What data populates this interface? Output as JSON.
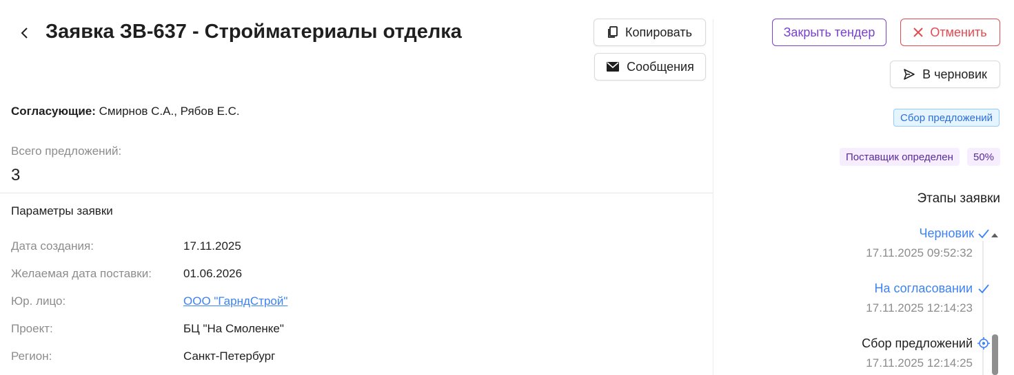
{
  "header": {
    "title": "Заявка ЗВ-637 - Стройматериалы отделка",
    "copy_label": "Копировать",
    "messages_label": "Сообщения"
  },
  "actions": {
    "close_tender_label": "Закрыть тендер",
    "cancel_label": "Отменить",
    "draft_label": "В черновик"
  },
  "approvers": {
    "label": "Согласующие:",
    "value": " Смирнов С.А., Рябов Е.С."
  },
  "offers": {
    "label": "Всего предложений:",
    "count": "3"
  },
  "params": {
    "section_title": "Параметры заявки",
    "rows": [
      {
        "label": "Дата создания:",
        "value": "17.11.2025"
      },
      {
        "label": "Желаемая дата поставки:",
        "value": "01.06.2026"
      },
      {
        "label": "Юр. лицо:",
        "value": "ООО \"ГарндСтрой\""
      },
      {
        "label": "Проект:",
        "value": "БЦ \"На Смоленке\""
      },
      {
        "label": "Регион:",
        "value": "Санкт-Петербург"
      }
    ]
  },
  "status": {
    "current": "Сбор предложений",
    "supplier": "Поставщик определен",
    "progress": "50%"
  },
  "stages": {
    "title": "Этапы заявки",
    "items": [
      {
        "name": "Черновик",
        "date": "17.11.2025 09:52:32",
        "state": "done"
      },
      {
        "name": "На согласовании",
        "date": "17.11.2025 12:14:23",
        "state": "done"
      },
      {
        "name": "Сбор предложений",
        "date": "17.11.2025 12:14:25",
        "state": "current"
      }
    ]
  },
  "colors": {
    "accent_blue": "#3b82f6",
    "purple": "#7a3fd1",
    "danger": "#e5484d",
    "tag_blue_bg": "#e6f4ff",
    "tag_purple_bg": "#f6edff"
  }
}
